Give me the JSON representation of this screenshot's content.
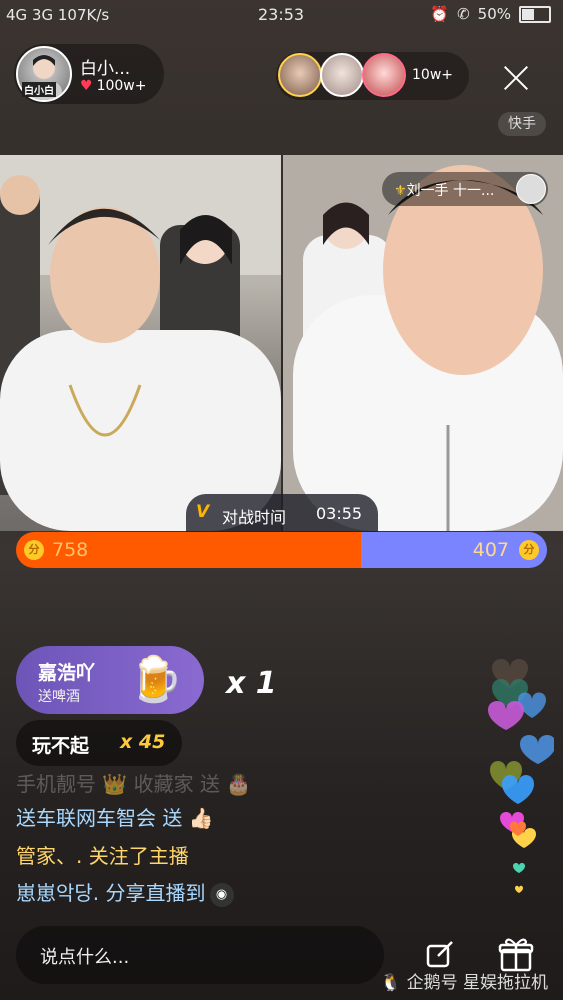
{
  "status_bar": {
    "network": "4G 3G 107K/s",
    "time": "23:53",
    "battery": "50%",
    "battery_level": 0.5
  },
  "host": {
    "name": "白小...",
    "likes": "100w+",
    "avatar_tag": "白小白"
  },
  "viewers": {
    "count": "10w+",
    "avatar_colors": [
      "#ffd24a",
      "#ffffff",
      "#ff6a8a"
    ]
  },
  "platform_badge": "快手",
  "opponent": {
    "name": "刘一手 十一..."
  },
  "battle": {
    "label": "对战时间",
    "time": "03:55"
  },
  "score": {
    "left": "758",
    "right": "407",
    "left_color": "#ff5a00",
    "right_color": "#7b84ff",
    "coin_symbol": "分"
  },
  "gifts": [
    {
      "user": "嘉浩吖",
      "desc": "送啤酒",
      "count": "x 1",
      "icon": "beer-icon"
    },
    {
      "user": "玩不起",
      "count": "x 45"
    }
  ],
  "chat": [
    "手机靓号 👑 收藏家 送 🎂",
    "送车联网车智会 送 👍🏻",
    "管家、. 关注了主播",
    "崽崽악당. 分享直播到"
  ],
  "comment_input": {
    "placeholder": "说点什么..."
  },
  "watermark": "企鹅号 星娱拖拉机"
}
